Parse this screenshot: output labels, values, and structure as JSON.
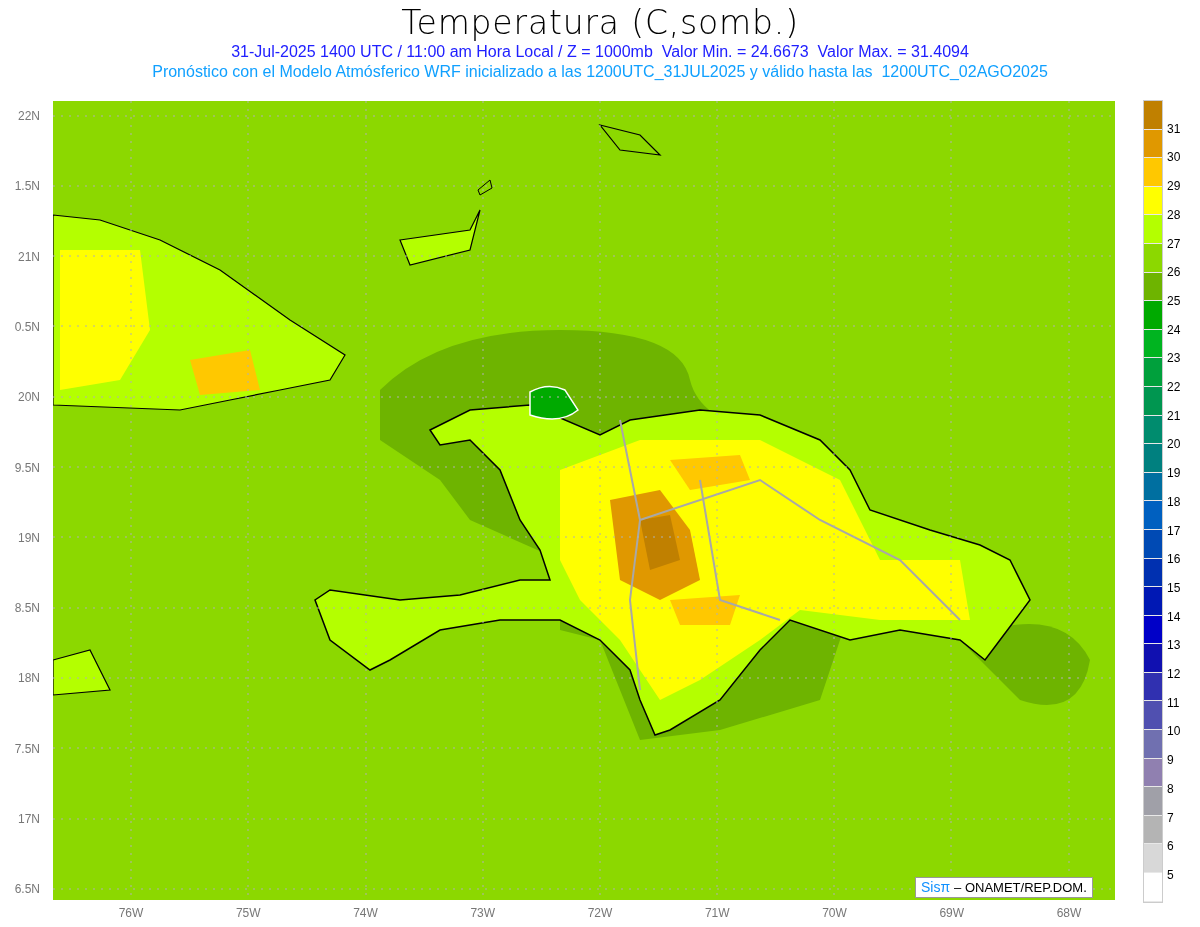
{
  "title": "Temperatura (C,somb.)",
  "subtitle": "31-Jul-2025 1400 UTC / 11:00 am Hora Local / Z = 1000mb  Valor Min. = 24.6673  Valor Max. = 31.4094",
  "model_note": "Pronóstico con el Modelo Atmósferico WRF inicializado a las 1200UTC_31JUL2025 y válido hasta las  1200UTC_02AGO2025",
  "y_axis_labels": [
    "22N",
    "1.5N",
    "21N",
    "0.5N",
    "20N",
    "9.5N",
    "19N",
    "8.5N",
    "18N",
    "7.5N",
    "17N",
    "6.5N"
  ],
  "x_axis_labels": [
    "76W",
    "75W",
    "74W",
    "73W",
    "72W",
    "71W",
    "70W",
    "69W",
    "68W"
  ],
  "legend": {
    "bins": [
      {
        "color": "#c08000"
      },
      {
        "color": "#e09800"
      },
      {
        "color": "#ffc800"
      },
      {
        "color": "#ffff00"
      },
      {
        "color": "#b4ff00"
      },
      {
        "color": "#8cd800"
      },
      {
        "color": "#6eb400"
      },
      {
        "color": "#00aa00"
      },
      {
        "color": "#00b420"
      },
      {
        "color": "#00a03c"
      },
      {
        "color": "#009650"
      },
      {
        "color": "#008c6e"
      },
      {
        "color": "#00807f"
      },
      {
        "color": "#006fa0"
      },
      {
        "color": "#0060c0"
      },
      {
        "color": "#004ab4"
      },
      {
        "color": "#0030b0"
      },
      {
        "color": "#0018b4"
      },
      {
        "color": "#0000c8"
      },
      {
        "color": "#1010b0"
      },
      {
        "color": "#3030b0"
      },
      {
        "color": "#5050b0"
      },
      {
        "color": "#7070b0"
      },
      {
        "color": "#9080b0"
      },
      {
        "color": "#a0a0a8"
      },
      {
        "color": "#b4b4b4"
      },
      {
        "color": "#d8d8d8"
      },
      {
        "color": "#ffffff"
      }
    ],
    "labels": [
      "31",
      "30",
      "29",
      "28",
      "27",
      "26",
      "25",
      "24",
      "23",
      "22",
      "21",
      "20",
      "19",
      "18",
      "17",
      "16",
      "15",
      "14",
      "13",
      "12",
      "11",
      "10",
      "9",
      "8",
      "7",
      "6",
      "5"
    ]
  },
  "credit": {
    "logo": "Sisπ",
    "text": "– ONAMET/REP.DOM."
  }
}
